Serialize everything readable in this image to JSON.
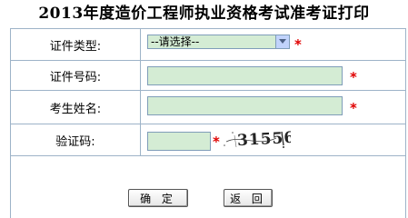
{
  "page": {
    "title": "2013年度造价工程师执业资格考试准考证打印"
  },
  "form": {
    "cert_type": {
      "label": "证件类型:",
      "selected": "--请选择--"
    },
    "cert_number": {
      "label": "证件号码:",
      "value": ""
    },
    "name": {
      "label": "考生姓名:",
      "value": ""
    },
    "captcha": {
      "label": "验证码:",
      "value": "",
      "code": "31556"
    },
    "required_mark": "*"
  },
  "buttons": {
    "confirm": "确 定",
    "back": "返 回"
  },
  "colors": {
    "input_bg": "#d4ecd4",
    "border": "#9db3c8",
    "required": "#e00000"
  }
}
